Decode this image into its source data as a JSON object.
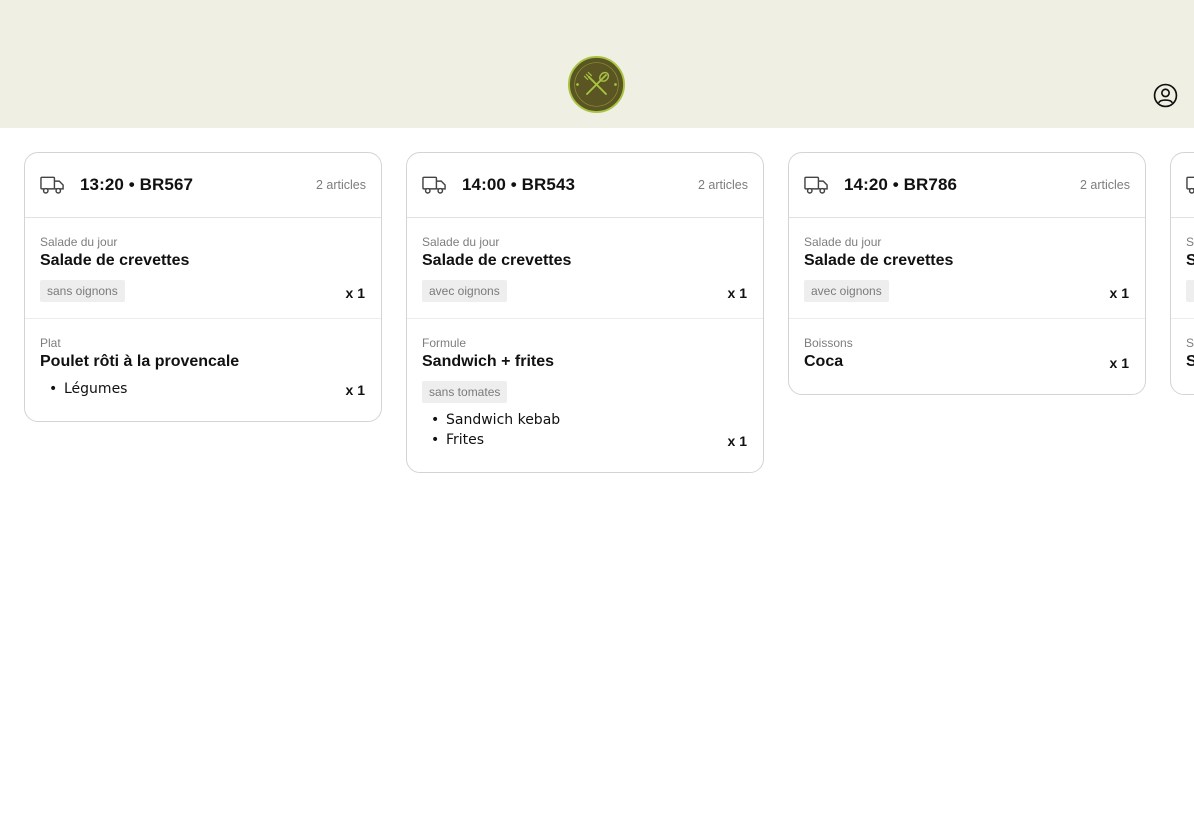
{
  "header": {
    "logo_text": "GRAINES DE SÉSAME",
    "account_icon": "user-circle-icon"
  },
  "orders": [
    {
      "title": "13:20 • BR567",
      "count": "2 articles",
      "items": [
        {
          "category": "Salade du jour",
          "name": "Salade de crevettes",
          "note": "sans oignons",
          "qty": "x 1"
        },
        {
          "category": "Plat",
          "name": "Poulet rôti à la provencale",
          "subitems": [
            "Légumes"
          ],
          "qty": "x 1"
        }
      ]
    },
    {
      "title": "14:00 • BR543",
      "count": "2 articles",
      "items": [
        {
          "category": "Salade du jour",
          "name": "Salade de crevettes",
          "note": "avec oignons",
          "qty": "x 1"
        },
        {
          "category": "Formule",
          "name": "Sandwich + frites",
          "note": "sans tomates",
          "subitems": [
            "Sandwich kebab",
            "Frites"
          ],
          "qty": "x 1"
        }
      ]
    },
    {
      "title": "14:20 • BR786",
      "count": "2 articles",
      "items": [
        {
          "category": "Salade du jour",
          "name": "Salade de crevettes",
          "note": "avec oignons",
          "qty": "x 1"
        },
        {
          "category": "Boissons",
          "name": "Coca",
          "qty": "x 1"
        }
      ]
    },
    {
      "title": "",
      "count": "",
      "items": [
        {
          "category": "S",
          "name": "S",
          "note": "",
          "qty": ""
        },
        {
          "category": "S",
          "name": "S",
          "qty": ""
        }
      ]
    }
  ],
  "colors": {
    "header_bg": "#eff0e3",
    "logo_fill": "#5b5523",
    "logo_accent": "#a8c443"
  }
}
